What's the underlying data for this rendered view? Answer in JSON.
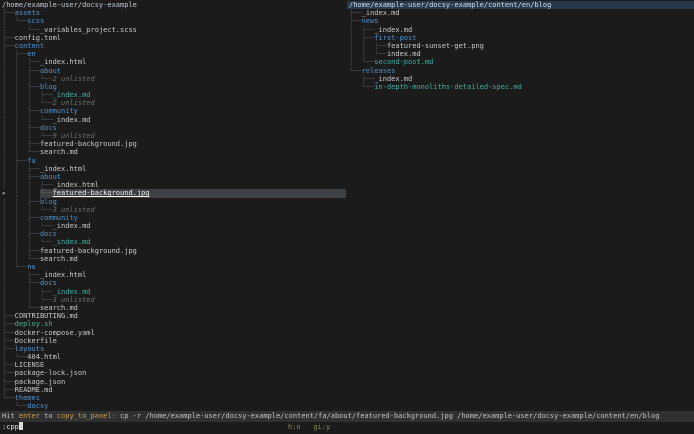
{
  "colors": {
    "background": "#1b1b1b",
    "default_text": "#c9c9c9",
    "directory": "#4e94d0",
    "git_changed": "#41b0a5",
    "executable": "#4fae8d",
    "unlisted": "#6e6e6e",
    "tree_branch": "#4d5156",
    "selection_bg": "#3d4144",
    "panel_header_bg": "#27394a",
    "status_bar_bg": "#303030",
    "status_key": "#c9a04e",
    "flags_text": "#8f8a52"
  },
  "left_panel": {
    "path": "/home/example-user/docsy-example",
    "rows": [
      {
        "p": "├──",
        "n": "assets",
        "t": "dir"
      },
      {
        "p": "│  └──",
        "n": "scss",
        "t": "dir"
      },
      {
        "p": "│     └──",
        "n": "_variables_project.scss",
        "t": "file"
      },
      {
        "p": "├──",
        "n": "config.toml",
        "t": "file"
      },
      {
        "p": "├──",
        "n": "content",
        "t": "dir"
      },
      {
        "p": "│  ├──",
        "n": "en",
        "t": "dir"
      },
      {
        "p": "│  │  ├──",
        "n": "_index.html",
        "t": "file"
      },
      {
        "p": "│  │  ├──",
        "n": "about",
        "t": "dir"
      },
      {
        "p": "│  │  │  └──",
        "n": "2 unlisted",
        "t": "unlisted"
      },
      {
        "p": "│  │  ├──",
        "n": "blog",
        "t": "dir"
      },
      {
        "p": "│  │  │  ├──",
        "n": "_index.md",
        "t": "git"
      },
      {
        "p": "│  │  │  └──",
        "n": "2 unlisted",
        "t": "unlisted"
      },
      {
        "p": "│  │  ├──",
        "n": "community",
        "t": "dir"
      },
      {
        "p": "│  │  │  └──",
        "n": "_index.md",
        "t": "file"
      },
      {
        "p": "│  │  ├──",
        "n": "docs",
        "t": "dir"
      },
      {
        "p": "│  │  │  └──",
        "n": "9 unlisted",
        "t": "unlisted"
      },
      {
        "p": "│  │  ├──",
        "n": "featured-background.jpg",
        "t": "file"
      },
      {
        "p": "│  │  └──",
        "n": "search.md",
        "t": "file"
      },
      {
        "p": "│  ├──",
        "n": "fa",
        "t": "dir"
      },
      {
        "p": "│  │  ├──",
        "n": "_index.html",
        "t": "file"
      },
      {
        "p": "│  │  ├──",
        "n": "about",
        "t": "dir"
      },
      {
        "p": "│  │  │  ├──",
        "n": "_index.html",
        "t": "file"
      },
      {
        "m": "▸",
        "p": "  │  │  ",
        "g": "└──",
        "n": "featured-background.jpg",
        "t": "sel"
      },
      {
        "p": "│  │  ├──",
        "n": "blog",
        "t": "dir"
      },
      {
        "p": "│  │  │  └──",
        "n": "3 unlisted",
        "t": "unlisted"
      },
      {
        "p": "│  │  ├──",
        "n": "community",
        "t": "dir"
      },
      {
        "p": "│  │  │  └──",
        "n": "_index.md",
        "t": "file"
      },
      {
        "p": "│  │  ├──",
        "n": "docs",
        "t": "dir"
      },
      {
        "p": "│  │  │  └──",
        "n": "_index.md",
        "t": "git"
      },
      {
        "p": "│  │  ├──",
        "n": "featured-background.jpg",
        "t": "file"
      },
      {
        "p": "│  │  └──",
        "n": "search.md",
        "t": "file"
      },
      {
        "p": "│  └──",
        "n": "no",
        "t": "dir"
      },
      {
        "p": "│     ├──",
        "n": "_index.html",
        "t": "file"
      },
      {
        "p": "│     ├──",
        "n": "docs",
        "t": "dir"
      },
      {
        "p": "│     │  ├──",
        "n": "_index.md",
        "t": "git"
      },
      {
        "p": "│     │  └──",
        "n": "3 unlisted",
        "t": "unlisted"
      },
      {
        "p": "│     └──",
        "n": "search.md",
        "t": "file"
      },
      {
        "p": "├──",
        "n": "CONTRIBUTING.md",
        "t": "file"
      },
      {
        "p": "├──",
        "n": "deploy.sh",
        "t": "exec"
      },
      {
        "p": "├──",
        "n": "docker-compose.yaml",
        "t": "file"
      },
      {
        "p": "├──",
        "n": "Dockerfile",
        "t": "file"
      },
      {
        "p": "├──",
        "n": "layouts",
        "t": "dir"
      },
      {
        "p": "│  └──",
        "n": "404.html",
        "t": "file"
      },
      {
        "p": "├──",
        "n": "LICENSE",
        "t": "file"
      },
      {
        "p": "├──",
        "n": "package-lock.json",
        "t": "file"
      },
      {
        "p": "├──",
        "n": "package.json",
        "t": "file"
      },
      {
        "p": "├──",
        "n": "README.md",
        "t": "file"
      },
      {
        "p": "└──",
        "n": "themes",
        "t": "dir"
      },
      {
        "p": "   └──",
        "n": "docsy",
        "t": "dir"
      }
    ]
  },
  "right_panel": {
    "path": "/home/example-user/docsy-example/content/en/blog",
    "rows": [
      {
        "p": "├──",
        "n": "_index.md",
        "t": "file"
      },
      {
        "p": "├──",
        "n": "news",
        "t": "dir"
      },
      {
        "p": "│  ├──",
        "n": "_index.md",
        "t": "file"
      },
      {
        "p": "│  ├──",
        "n": "first-post",
        "t": "dir"
      },
      {
        "p": "│  │  ├──",
        "n": "featured-sunset-get.png",
        "t": "file"
      },
      {
        "p": "│  │  └──",
        "n": "index.md",
        "t": "file"
      },
      {
        "p": "│  └──",
        "n": "second-post.md",
        "t": "git"
      },
      {
        "p": "└──",
        "n": "releases",
        "t": "dir"
      },
      {
        "p": "   ├──",
        "n": "_index.md",
        "t": "file"
      },
      {
        "p": "   └──",
        "n": "in-depth-monoliths-detailed-spec.md",
        "t": "git"
      }
    ]
  },
  "status_bar": {
    "hit": "Hit ",
    "key": "enter",
    "to": " to ",
    "verb": "copy_to_panel:",
    "command": " cp -r /home/example-user/docsy-example/content/fa/about/featured-background.jpg /home/example-user/docsy-example/content/en/blog"
  },
  "input_line": {
    "value": ":cpp",
    "flag_hidden": "h:n",
    "flag_gap": "   ",
    "flag_gitignore": "gi:y"
  }
}
